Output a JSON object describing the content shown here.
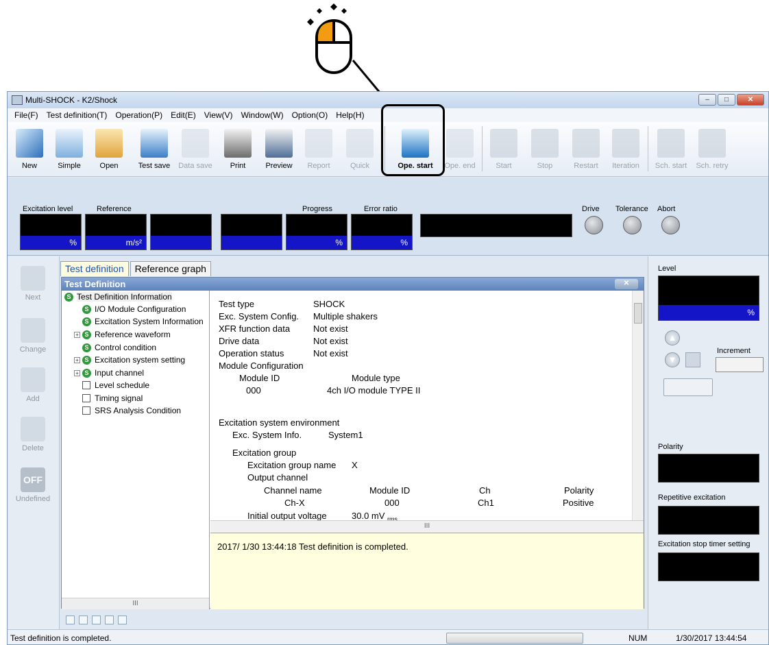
{
  "window": {
    "title": "Multi-SHOCK - K2/Shock",
    "buttons": [
      "–",
      "□",
      "✕"
    ]
  },
  "menu": [
    "File(F)",
    "Test definition(T)",
    "Operation(P)",
    "Edit(E)",
    "View(V)",
    "Window(W)",
    "Option(O)",
    "Help(H)"
  ],
  "toolbar": [
    {
      "label": "New",
      "icon": "new-icon",
      "enabled": true
    },
    {
      "label": "Simple",
      "icon": "simple-icon",
      "enabled": true
    },
    {
      "label": "Open",
      "icon": "open-folder-icon",
      "enabled": true
    },
    {
      "label": "Test save",
      "icon": "test-save-icon",
      "enabled": true
    },
    {
      "label": "Data save",
      "icon": "data-save-icon",
      "enabled": false
    },
    {
      "label": "Print",
      "icon": "printer-icon",
      "enabled": true
    },
    {
      "label": "Preview",
      "icon": "preview-icon",
      "enabled": true
    },
    {
      "label": "Report",
      "icon": "report-icon",
      "enabled": false
    },
    {
      "label": "Quick",
      "icon": "quick-icon",
      "enabled": false
    },
    {
      "label": "Ope. start",
      "icon": "operation-start-icon",
      "enabled": true
    },
    {
      "label": "Ope. end",
      "icon": "operation-end-icon",
      "enabled": false
    },
    {
      "label": "Start",
      "icon": "play-icon",
      "enabled": false
    },
    {
      "label": "Stop",
      "icon": "stop-icon",
      "enabled": false
    },
    {
      "label": "Restart",
      "icon": "restart-icon",
      "enabled": false
    },
    {
      "label": "Iteration",
      "icon": "iteration-icon",
      "enabled": false
    },
    {
      "label": "Sch. start",
      "icon": "schedule-start-icon",
      "enabled": false
    },
    {
      "label": "Sch. retry",
      "icon": "schedule-retry-icon",
      "enabled": false
    }
  ],
  "monitor": {
    "labels": {
      "excitation_level": "Excitation level",
      "reference": "Reference",
      "progress": "Progress",
      "error_ratio": "Error ratio",
      "drive": "Drive",
      "tolerance": "Tolerance",
      "abort": "Abort"
    },
    "units": {
      "level": "%",
      "reference": "m/s²",
      "progress": "%",
      "error_ratio": "%"
    }
  },
  "left_buttons": [
    {
      "label": "Next",
      "icon": "next-arrow-icon"
    },
    {
      "label": "Change",
      "icon": "pencil-icon"
    },
    {
      "label": "Add",
      "icon": "add-icon"
    },
    {
      "label": "Delete",
      "icon": "delete-x-icon"
    },
    {
      "label": "Undefined",
      "icon": "off-icon",
      "icon_text": "OFF"
    }
  ],
  "tabs": [
    "Test definition",
    "Reference graph"
  ],
  "test_definition": {
    "title": "Test Definition",
    "tree": [
      {
        "label": "Test Definition Information",
        "status": "S",
        "level": 0
      },
      {
        "label": "I/O Module Configuration",
        "status": "S",
        "level": 1
      },
      {
        "label": "Excitation System Information",
        "status": "S",
        "level": 1
      },
      {
        "label": "Reference waveform",
        "status": "S",
        "level": 1,
        "expandable": true
      },
      {
        "label": "Control condition",
        "status": "S",
        "level": 1
      },
      {
        "label": "Excitation system setting",
        "status": "S",
        "level": 1,
        "expandable": true
      },
      {
        "label": "Input channel",
        "status": "S",
        "level": 1,
        "expandable": true
      },
      {
        "label": "Level schedule",
        "status": "",
        "level": 1
      },
      {
        "label": "Timing signal",
        "status": "",
        "level": 1
      },
      {
        "label": "SRS Analysis Condition",
        "status": "",
        "level": 1
      }
    ],
    "scroll_glyph": "III",
    "details": {
      "test_type_label": "Test type",
      "test_type": "SHOCK",
      "exc_config_label": "Exc. System Config.",
      "exc_config": "Multiple shakers",
      "xfr_label": "XFR function data",
      "xfr": "Not exist",
      "drive_label": "Drive data",
      "drive": "Not exist",
      "op_status_label": "Operation status",
      "op_status": "Not exist",
      "module_config_label": "Module Configuration",
      "module_id_label": "Module ID",
      "module_type_label": "Module type",
      "module_id": "000",
      "module_type": "4ch I/O module TYPE II",
      "exc_env_label": "Excitation system environment",
      "exc_info_label": "Exc. System Info.",
      "exc_info": "System1",
      "exc_group_label": "Excitation group",
      "exc_group_name_label": "Excitation group name",
      "exc_group_name": "X",
      "output_channel_label": "Output channel",
      "oc_headers": [
        "Channel name",
        "Module ID",
        "Ch",
        "Polarity"
      ],
      "oc_row": [
        "Ch-X",
        "000",
        "Ch1",
        "Positive"
      ],
      "initial_voltage_label": "Initial output voltage",
      "initial_voltage": "30.0 mV",
      "initial_voltage_unit": "rms"
    },
    "message": "2017/ 1/30 13:44:18 Test definition is completed."
  },
  "right_panel": {
    "level_label": "Level",
    "level_unit": "%",
    "increment_label": "Increment",
    "polarity_label": "Polarity",
    "repetitive_label": "Repetitive excitation",
    "stop_timer_label": "Excitation stop timer setting"
  },
  "status": {
    "message": "Test definition is completed.",
    "num": "NUM",
    "datetime": "1/30/2017  13:44:54"
  },
  "colors": {
    "accent_blue": "#1515c8",
    "monitor_black": "#000000",
    "mouse_orange": "#f39c12",
    "status_green": "#2e9a3a"
  }
}
